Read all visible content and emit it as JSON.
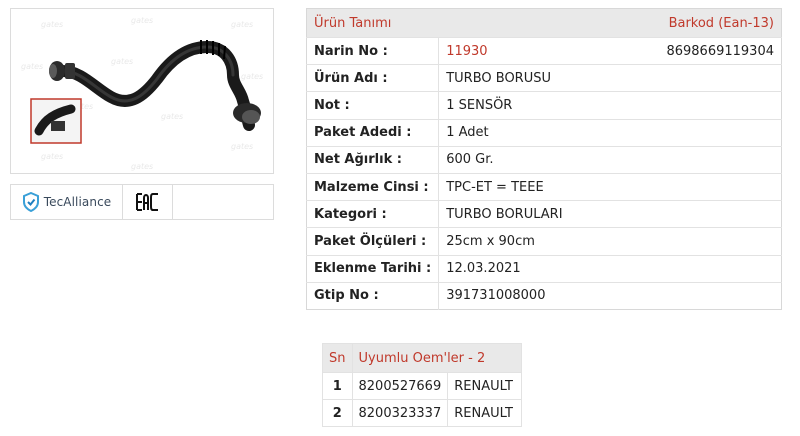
{
  "product_image": {
    "icon": "turbo-hose-image",
    "watermark": "gates"
  },
  "logos": {
    "tecalliance": {
      "icon": "tecalliance-shield-icon",
      "name": "TecAlliance"
    },
    "eac": {
      "icon": "eac-mark-icon",
      "text": "EAC"
    }
  },
  "info": {
    "header": {
      "left": "Ürün Tanımı",
      "right": "Barkod (Ean-13)"
    },
    "rows": [
      {
        "label": "Narin No :",
        "value": "11930",
        "extra": "8698669119304"
      },
      {
        "label": "Ürün Adı :",
        "value": "TURBO BORUSU"
      },
      {
        "label": "Not :",
        "value": "1 SENSÖR"
      },
      {
        "label": "Paket Adedi :",
        "value": "1 Adet"
      },
      {
        "label": "Net Ağırlık :",
        "value": "600 Gr."
      },
      {
        "label": "Malzeme Cinsi :",
        "value": "TPC-ET = TEEE"
      },
      {
        "label": "Kategori :",
        "value": "TURBO BORULARI"
      },
      {
        "label": "Paket Ölçüleri :",
        "value": "25cm x 90cm"
      },
      {
        "label": "Eklenme Tarihi :",
        "value": "12.03.2021"
      },
      {
        "label": "Gtip No :",
        "value": "391731008000"
      }
    ]
  },
  "oem": {
    "header": {
      "sn": "Sn",
      "title": "Uyumlu Oem'ler - 2"
    },
    "rows": [
      {
        "sn": "1",
        "code": "8200527669",
        "brand": "RENAULT"
      },
      {
        "sn": "2",
        "code": "8200323337",
        "brand": "RENAULT"
      }
    ]
  },
  "colors": {
    "accent_red": "#c0392b",
    "header_bg": "#e9e9e9",
    "border": "#d8d8d8"
  }
}
